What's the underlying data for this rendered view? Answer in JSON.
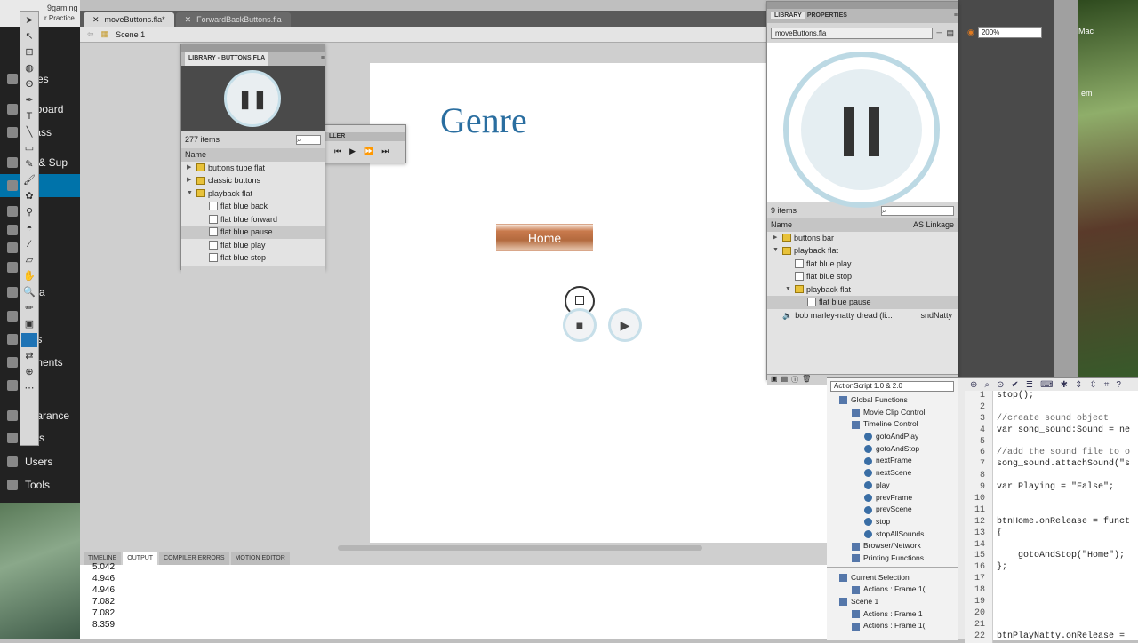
{
  "wp_sidebar": {
    "items": [
      {
        "label": "Sites"
      },
      {
        "label": "shboard"
      },
      {
        "label": "Class"
      },
      {
        "label": "ail & Sup"
      },
      {
        "label": "sts"
      },
      {
        "label": "All"
      },
      {
        "label": "Ad"
      },
      {
        "label": "Ca"
      },
      {
        "label": "Ta"
      },
      {
        "label": "edia"
      },
      {
        "label": "ks"
      },
      {
        "label": "ges"
      },
      {
        "label": "mments"
      },
      {
        "label": "ds"
      },
      {
        "label": "pearance"
      },
      {
        "label": "gins"
      },
      {
        "label": "Users"
      },
      {
        "label": "Tools"
      }
    ],
    "browser_tab": "9gaming",
    "browser_sub": "r Practice"
  },
  "doc_tabs": [
    "moveButtons.fla*",
    "ForwardBackButtons.fla"
  ],
  "edit_bar": {
    "scene": "Scene 1"
  },
  "stage": {
    "title": "Genre",
    "home_button": "Home"
  },
  "output_panel": {
    "tabs": [
      "TIMELINE",
      "OUTPUT",
      "COMPILER ERRORS",
      "MOTION EDITOR"
    ],
    "lines": [
      "5.042",
      "4.946",
      "4.946",
      "7.082",
      "7.082",
      "8.359"
    ]
  },
  "library_small": {
    "title": "LIBRARY - BUTTONS.FLA",
    "count": "277 items",
    "col_name": "Name",
    "rows": [
      {
        "label": "buttons tube flat",
        "type": "folder"
      },
      {
        "label": "classic buttons",
        "type": "folder"
      },
      {
        "label": "playback flat",
        "type": "folder-open"
      },
      {
        "label": "flat blue back",
        "type": "symbol"
      },
      {
        "label": "flat blue forward",
        "type": "symbol"
      },
      {
        "label": "flat blue pause",
        "type": "symbol"
      },
      {
        "label": "flat blue play",
        "type": "symbol"
      },
      {
        "label": "flat blue stop",
        "type": "symbol"
      }
    ]
  },
  "controller": {
    "title": "LLER"
  },
  "library_big": {
    "tab_library": "LIBRARY",
    "tab_properties": "PROPERTIES",
    "file": "moveButtons.fla",
    "count": "9 items",
    "col_name": "Name",
    "col_linkage": "AS Linkage",
    "rows": [
      {
        "label": "buttons bar",
        "type": "folder",
        "indent": 0,
        "linkage": ""
      },
      {
        "label": "playback flat",
        "type": "folder-open",
        "indent": 0,
        "linkage": ""
      },
      {
        "label": "flat blue play",
        "type": "symbol",
        "indent": 1,
        "linkage": ""
      },
      {
        "label": "flat blue stop",
        "type": "symbol",
        "indent": 1,
        "linkage": ""
      },
      {
        "label": "playback flat",
        "type": "folder-open",
        "indent": 1,
        "linkage": ""
      },
      {
        "label": "flat blue pause",
        "type": "symbol",
        "indent": 2,
        "linkage": ""
      },
      {
        "label": "bob marley-natty dread (li...",
        "type": "sound",
        "indent": 0,
        "linkage": "sndNatty"
      }
    ]
  },
  "zoom": "200%",
  "actions": {
    "version": "ActionScript 1.0 & 2.0",
    "tree": [
      {
        "label": "Global Functions",
        "indent": 0
      },
      {
        "label": "Movie Clip Control",
        "indent": 1
      },
      {
        "label": "Timeline Control",
        "indent": 1
      },
      {
        "label": "gotoAndPlay",
        "indent": 2
      },
      {
        "label": "gotoAndStop",
        "indent": 2
      },
      {
        "label": "nextFrame",
        "indent": 2
      },
      {
        "label": "nextScene",
        "indent": 2
      },
      {
        "label": "play",
        "indent": 2
      },
      {
        "label": "prevFrame",
        "indent": 2
      },
      {
        "label": "prevScene",
        "indent": 2
      },
      {
        "label": "stop",
        "indent": 2
      },
      {
        "label": "stopAllSounds",
        "indent": 2
      },
      {
        "label": "Browser/Network",
        "indent": 1
      },
      {
        "label": "Printing Functions",
        "indent": 1
      }
    ],
    "tree2": [
      {
        "label": "Current Selection",
        "indent": 0
      },
      {
        "label": "Actions : Frame 1(",
        "indent": 1
      },
      {
        "label": "Scene 1",
        "indent": 0
      },
      {
        "label": "Actions : Frame 1",
        "indent": 1
      },
      {
        "label": "Actions : Frame 1(",
        "indent": 1
      }
    ],
    "code": [
      {
        "n": "1",
        "t": "stop();"
      },
      {
        "n": "2",
        "t": ""
      },
      {
        "n": "3",
        "t": "//create sound object"
      },
      {
        "n": "4",
        "t": "var song_sound:Sound = ne"
      },
      {
        "n": "5",
        "t": ""
      },
      {
        "n": "6",
        "t": "//add the sound file to o"
      },
      {
        "n": "7",
        "t": "song_sound.attachSound(\"s"
      },
      {
        "n": "8",
        "t": ""
      },
      {
        "n": "9",
        "t": "var Playing = \"False\";"
      },
      {
        "n": "10",
        "t": ""
      },
      {
        "n": "11",
        "t": ""
      },
      {
        "n": "12",
        "t": "btnHome.onRelease = funct"
      },
      {
        "n": "13",
        "t": "{"
      },
      {
        "n": "14",
        "t": ""
      },
      {
        "n": "15",
        "t": "    gotoAndStop(\"Home\");"
      },
      {
        "n": "16",
        "t": "};"
      },
      {
        "n": "17",
        "t": ""
      },
      {
        "n": "18",
        "t": ""
      },
      {
        "n": "19",
        "t": ""
      },
      {
        "n": "20",
        "t": ""
      },
      {
        "n": "21",
        "t": ""
      },
      {
        "n": "22",
        "t": "btnPlayNatty.onRelease ="
      }
    ]
  },
  "right_edge": {
    "labels": [
      "Mac",
      "em"
    ]
  }
}
